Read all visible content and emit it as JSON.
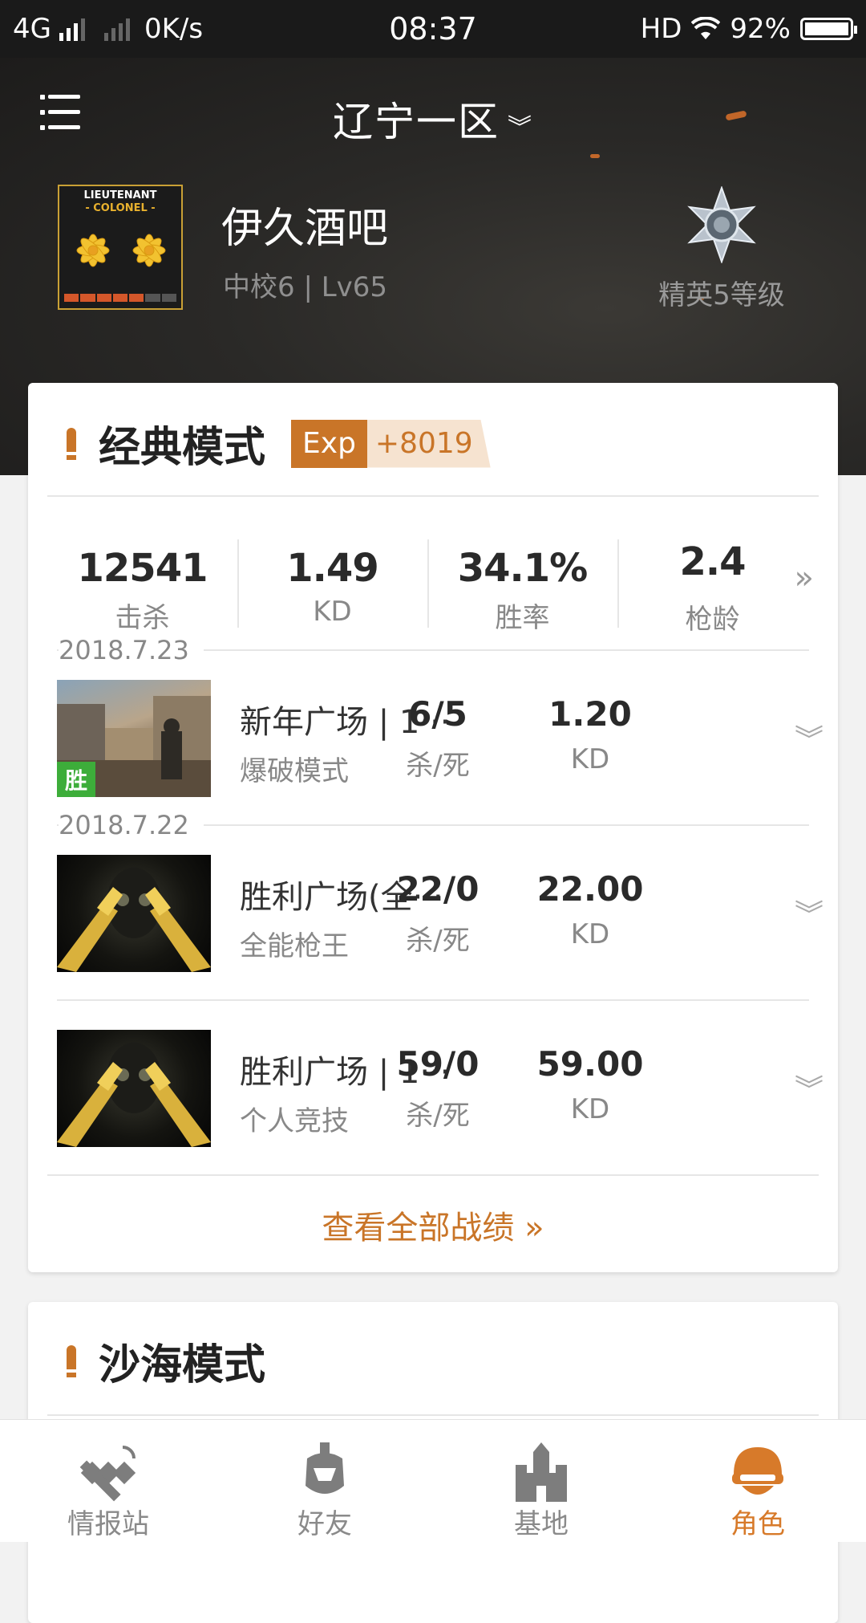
{
  "status_bar": {
    "network": "4G",
    "speed": "0K/s",
    "time": "08:37",
    "hd": "HD",
    "battery": "92%"
  },
  "header": {
    "server": "辽宁一区",
    "rank_badge": {
      "line1": "LIEUTENANT",
      "line2": "- COLONEL -"
    },
    "player_name": "伊久酒吧",
    "player_sub": "中校6 | Lv65",
    "elite_label": "精英5等级"
  },
  "classic": {
    "title": "经典模式",
    "exp_label": "Exp",
    "exp_value": "+8019",
    "stats": [
      {
        "value": "12541",
        "label": "击杀"
      },
      {
        "value": "1.49",
        "label": "KD"
      },
      {
        "value": "34.1%",
        "label": "胜率"
      },
      {
        "value": "2.4",
        "label": "枪龄"
      }
    ],
    "matches": [
      {
        "date": "2018.7.23",
        "map": "新年广场 | 1···",
        "mode": "爆破模式",
        "kd_pair": "6/5",
        "kd_pair_label": "杀/死",
        "kd": "1.20",
        "kd_label": "KD",
        "result": "胜"
      },
      {
        "date": "2018.7.22",
        "map": "胜利广场(全···",
        "mode": "全能枪王",
        "kd_pair": "22/0",
        "kd_pair_label": "杀/死",
        "kd": "22.00",
        "kd_label": "KD"
      },
      {
        "map": "胜利广场 | 1···",
        "mode": "个人竞技",
        "kd_pair": "59/0",
        "kd_pair_label": "杀/死",
        "kd": "59.00",
        "kd_label": "KD"
      }
    ],
    "view_all": "查看全部战绩 »"
  },
  "desert": {
    "title": "沙海模式"
  },
  "nav": [
    {
      "label": "情报站",
      "icon": "satellite-icon"
    },
    {
      "label": "好友",
      "icon": "helmet-friends-icon"
    },
    {
      "label": "基地",
      "icon": "castle-icon"
    },
    {
      "label": "角色",
      "icon": "character-helmet-icon",
      "active": true
    }
  ],
  "colors": {
    "accent": "#c97528",
    "win_badge": "#3dad3a",
    "header_bg": "#2a2927"
  }
}
